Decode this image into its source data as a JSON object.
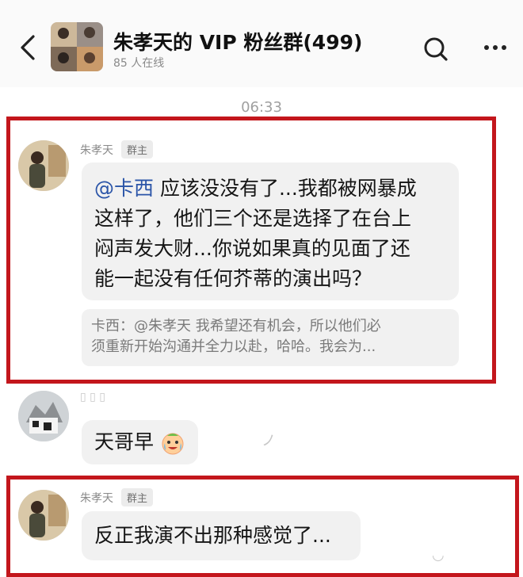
{
  "header": {
    "title": "朱孝天的 VIP 粉丝群(499)",
    "online": "85 人在线",
    "back_icon": "chevron-left-icon",
    "search_icon": "search-icon",
    "more_icon": "more-dots-icon"
  },
  "chat": {
    "timestamp": "06:33",
    "messages": [
      {
        "sender": "朱孝天",
        "badge": "群主",
        "mention": "@卡西",
        "text_lines": [
          " 应该没没有了...我都被网暴成",
          "这样了，他们三个还是选择了在台上",
          "闷声发大财...你说如果真的见面了还",
          "能一起没有任何芥蒂的演出吗？"
        ],
        "quote_lines": [
          "卡西：@朱孝天 我希望还有机会，所以他们必",
          "须重新开始沟通并全力以赴，哈哈。我会为..."
        ],
        "highlighted": true
      },
      {
        "sender": "",
        "text": "天哥早",
        "emoji": "crying-laughing-face-icon",
        "highlighted": false
      },
      {
        "sender": "朱孝天",
        "badge": "群主",
        "text": "反正我演不出那种感觉了...",
        "highlighted": true
      }
    ]
  },
  "colors": {
    "highlight": "#c3161c",
    "bubble": "#f1f1f1",
    "mention": "#2b55a8"
  }
}
